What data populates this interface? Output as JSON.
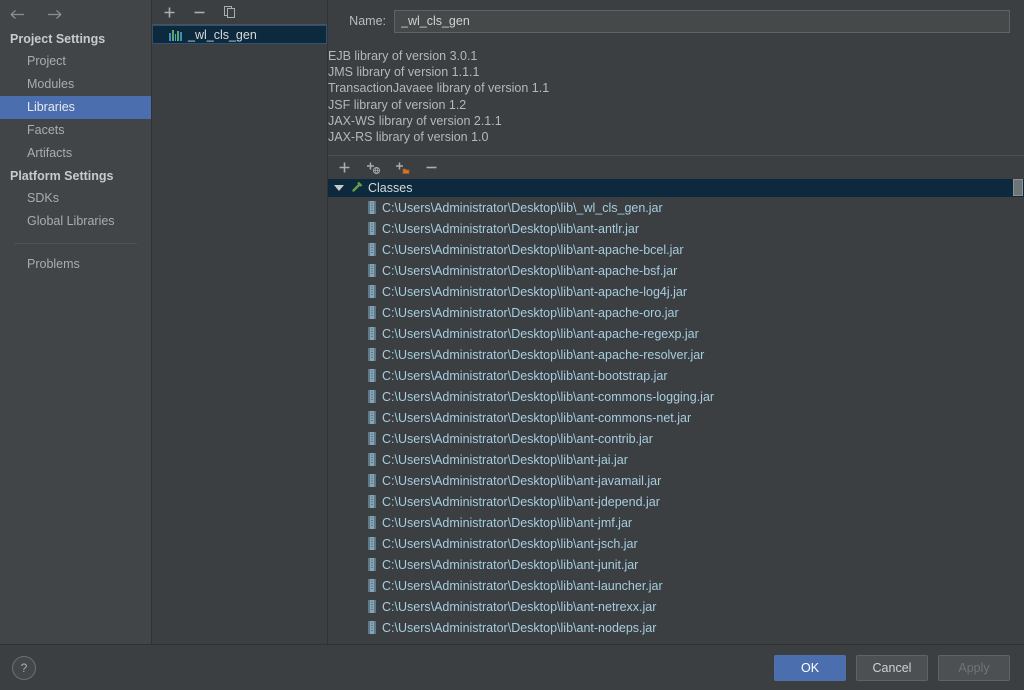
{
  "nav": {
    "back_icon": "arrow-left-icon",
    "forward_icon": "arrow-right-icon",
    "sections": [
      {
        "title": "Project Settings",
        "items": [
          {
            "label": "Project",
            "selected": false
          },
          {
            "label": "Modules",
            "selected": false
          },
          {
            "label": "Libraries",
            "selected": true
          },
          {
            "label": "Facets",
            "selected": false
          },
          {
            "label": "Artifacts",
            "selected": false
          }
        ]
      },
      {
        "title": "Platform Settings",
        "items": [
          {
            "label": "SDKs",
            "selected": false
          },
          {
            "label": "Global Libraries",
            "selected": false
          }
        ]
      }
    ],
    "problems_label": "Problems"
  },
  "libraries_panel": {
    "toolbar": [
      {
        "name": "add-library-button",
        "glyph": "+"
      },
      {
        "name": "remove-library-button",
        "glyph": "−"
      },
      {
        "name": "copy-library-button",
        "glyph": "copy-icon"
      }
    ],
    "items": [
      {
        "label": "_wl_cls_gen",
        "selected": true
      }
    ]
  },
  "details": {
    "name_label": "Name:",
    "name_value": "_wl_cls_gen",
    "name_placeholder": "Library name",
    "versions": [
      "EJB library of version 3.0.1",
      "JMS library of version 1.1.1",
      "TransactionJavaee library of version 1.1",
      "JSF library of version 1.2",
      "JAX-WS library of version 2.1.1",
      "JAX-RS library of version 1.0"
    ],
    "roots_toolbar": [
      {
        "name": "attach-files-button",
        "glyph": "+"
      },
      {
        "name": "attach-classes-button",
        "glyph": "+globe"
      },
      {
        "name": "attach-directory-button",
        "glyph": "+folder"
      },
      {
        "name": "remove-root-button",
        "glyph": "−"
      }
    ],
    "tree": {
      "root_label": "Classes",
      "root_icon": "hammer-icon",
      "expanded": true,
      "entries": [
        "C:\\Users\\Administrator\\Desktop\\lib\\_wl_cls_gen.jar",
        "C:\\Users\\Administrator\\Desktop\\lib\\ant-antlr.jar",
        "C:\\Users\\Administrator\\Desktop\\lib\\ant-apache-bcel.jar",
        "C:\\Users\\Administrator\\Desktop\\lib\\ant-apache-bsf.jar",
        "C:\\Users\\Administrator\\Desktop\\lib\\ant-apache-log4j.jar",
        "C:\\Users\\Administrator\\Desktop\\lib\\ant-apache-oro.jar",
        "C:\\Users\\Administrator\\Desktop\\lib\\ant-apache-regexp.jar",
        "C:\\Users\\Administrator\\Desktop\\lib\\ant-apache-resolver.jar",
        "C:\\Users\\Administrator\\Desktop\\lib\\ant-bootstrap.jar",
        "C:\\Users\\Administrator\\Desktop\\lib\\ant-commons-logging.jar",
        "C:\\Users\\Administrator\\Desktop\\lib\\ant-commons-net.jar",
        "C:\\Users\\Administrator\\Desktop\\lib\\ant-contrib.jar",
        "C:\\Users\\Administrator\\Desktop\\lib\\ant-jai.jar",
        "C:\\Users\\Administrator\\Desktop\\lib\\ant-javamail.jar",
        "C:\\Users\\Administrator\\Desktop\\lib\\ant-jdepend.jar",
        "C:\\Users\\Administrator\\Desktop\\lib\\ant-jmf.jar",
        "C:\\Users\\Administrator\\Desktop\\lib\\ant-jsch.jar",
        "C:\\Users\\Administrator\\Desktop\\lib\\ant-junit.jar",
        "C:\\Users\\Administrator\\Desktop\\lib\\ant-launcher.jar",
        "C:\\Users\\Administrator\\Desktop\\lib\\ant-netrexx.jar",
        "C:\\Users\\Administrator\\Desktop\\lib\\ant-nodeps.jar"
      ]
    }
  },
  "footer": {
    "help_label": "?",
    "ok_label": "OK",
    "cancel_label": "Cancel",
    "apply_label": "Apply",
    "apply_enabled": false
  },
  "colors": {
    "background": "#3c3f41",
    "selection_blue": "#4b6eaf",
    "tree_selection": "#0d293e",
    "jar_text": "#a6cde0",
    "accent_green": "#6a9e3f"
  }
}
